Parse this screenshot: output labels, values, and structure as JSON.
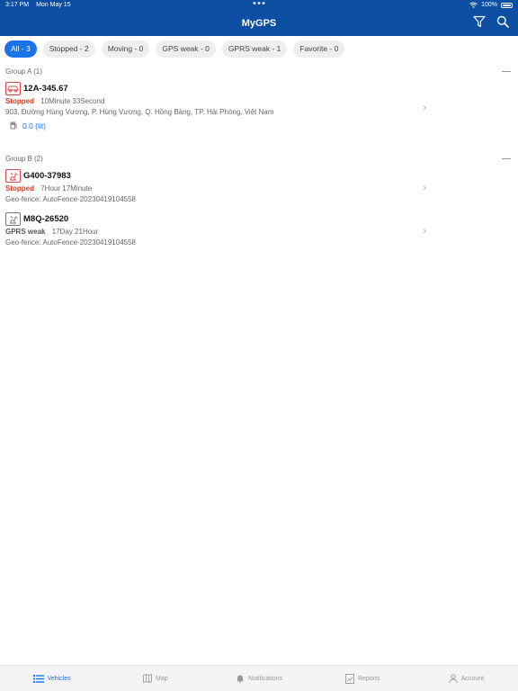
{
  "status_bar": {
    "time": "3:17 PM",
    "date": "Mon May 15",
    "battery": "100%"
  },
  "header": {
    "title": "MyGPS",
    "filter_icon": "filter-icon",
    "search_icon": "search-icon"
  },
  "filters": [
    {
      "label": "All - 3",
      "active": true
    },
    {
      "label": "Stopped - 2",
      "active": false
    },
    {
      "label": "Moving - 0",
      "active": false
    },
    {
      "label": "GPS weak - 0",
      "active": false
    },
    {
      "label": "GPRS weak - 1",
      "active": false
    },
    {
      "label": "Favorite - 0",
      "active": false
    }
  ],
  "groups": [
    {
      "title": "Group A (1)",
      "vehicles": [
        {
          "plate": "12A-345.67",
          "status": "Stopped",
          "duration": "10Minute 33Second",
          "address": "903, Đường Hùng Vương, P. Hùng Vương, Q. Hồng Bàng, TP. Hải Phòng, Việt Nam",
          "fuel": "0.0 (lit)"
        }
      ]
    },
    {
      "title": "Group B (2)",
      "vehicles": [
        {
          "plate": "G400-37983",
          "status": "Stopped",
          "duration": "7Hour 17Minute",
          "address": "Geo-fence: AutoFence-20230419104558"
        },
        {
          "plate": "M8Q-26520",
          "status": "GPRS weak",
          "duration": "17Day 21Hour",
          "address": "Geo-fence: AutoFence-20230419104558"
        }
      ]
    }
  ],
  "tabs": [
    {
      "label": "Vehicles",
      "icon": "list-icon",
      "active": true
    },
    {
      "label": "Map",
      "icon": "map-icon",
      "active": false
    },
    {
      "label": "Notifications",
      "icon": "bell-icon",
      "active": false
    },
    {
      "label": "Reports",
      "icon": "report-icon",
      "active": false
    },
    {
      "label": "Account",
      "icon": "user-icon",
      "active": false
    }
  ],
  "colors": {
    "header": "#0b4ea2",
    "accent": "#1a73e8",
    "stopped": "#d93a1a"
  }
}
